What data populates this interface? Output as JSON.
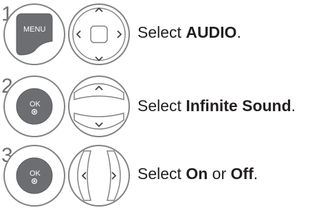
{
  "steps": [
    {
      "number": "1",
      "key_label": "MENU",
      "key_icon": "menu-key-icon",
      "nav_icon": "four-way-navigation-icon",
      "text_prefix": "Select ",
      "text_bold": "AUDIO",
      "text_suffix": "."
    },
    {
      "number": "2",
      "key_label": "OK",
      "key_icon": "ok-key-icon",
      "nav_icon": "up-down-navigation-icon",
      "text_prefix": "Select ",
      "text_bold": "Infinite Sound",
      "text_suffix": "."
    },
    {
      "number": "3",
      "key_label": "OK",
      "key_icon": "ok-key-icon",
      "nav_icon": "left-right-navigation-icon",
      "text_prefix": "Select ",
      "text_bold": "On",
      "text_middle": " or ",
      "text_bold2": "Off",
      "text_suffix": "."
    }
  ]
}
